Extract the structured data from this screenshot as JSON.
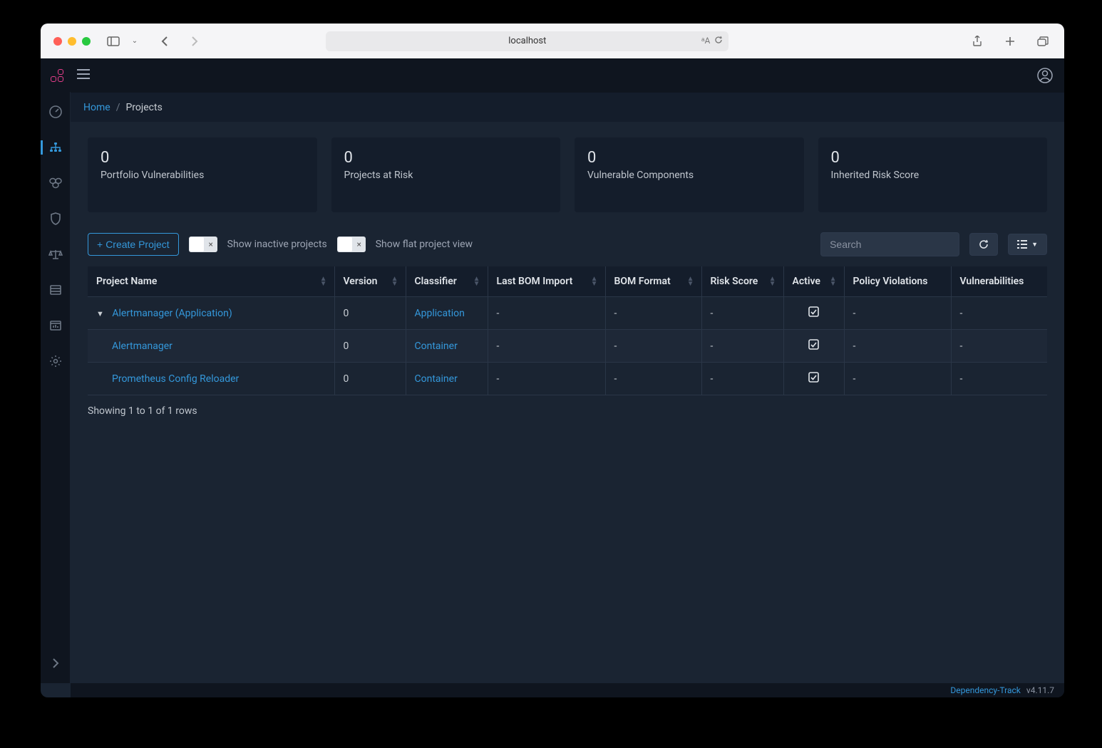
{
  "browser": {
    "address": "localhost"
  },
  "breadcrumb": {
    "home": "Home",
    "current": "Projects"
  },
  "stats": [
    {
      "value": "0",
      "label": "Portfolio Vulnerabilities"
    },
    {
      "value": "0",
      "label": "Projects at Risk"
    },
    {
      "value": "0",
      "label": "Vulnerable Components"
    },
    {
      "value": "0",
      "label": "Inherited Risk Score"
    }
  ],
  "toolbar": {
    "create_label": "Create Project",
    "toggle1_label": "Show inactive projects",
    "toggle2_label": "Show flat project view",
    "search_placeholder": "Search"
  },
  "table": {
    "columns": [
      "Project Name",
      "Version",
      "Classifier",
      "Last BOM Import",
      "BOM Format",
      "Risk Score",
      "Active",
      "Policy Violations",
      "Vulnerabilities"
    ],
    "rows": [
      {
        "name": "Alertmanager (Application)",
        "indent": 0,
        "expand": true,
        "version": "0",
        "classifier": "Application",
        "last_bom": "-",
        "bom_format": "-",
        "risk": "-",
        "active": true,
        "policy": "-",
        "vuln": "-"
      },
      {
        "name": "Alertmanager",
        "indent": 1,
        "expand": false,
        "version": "0",
        "classifier": "Container",
        "last_bom": "-",
        "bom_format": "-",
        "risk": "-",
        "active": true,
        "policy": "-",
        "vuln": "-"
      },
      {
        "name": "Prometheus Config Reloader",
        "indent": 1,
        "expand": false,
        "version": "0",
        "classifier": "Container",
        "last_bom": "-",
        "bom_format": "-",
        "risk": "-",
        "active": true,
        "policy": "-",
        "vuln": "-"
      }
    ]
  },
  "pagination": "Showing 1 to 1 of 1 rows",
  "footer": {
    "brand": "Dependency-Track",
    "version": "v4.11.7"
  }
}
